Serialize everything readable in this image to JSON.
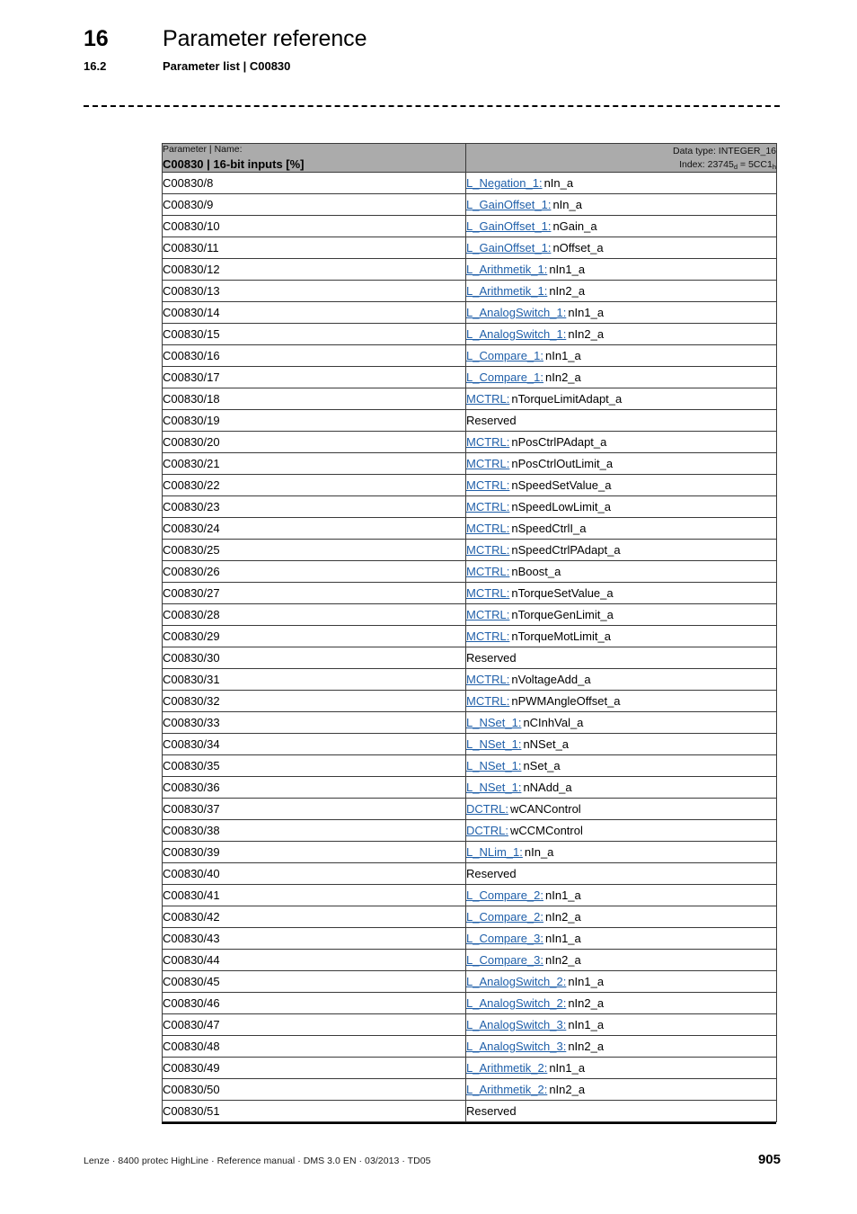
{
  "header": {
    "chapter_number": "16",
    "chapter_title": "Parameter reference",
    "section_number": "16.2",
    "section_title": "Parameter list | C00830"
  },
  "table": {
    "head": {
      "caption": "Parameter | Name:",
      "title": "C00830 | 16-bit inputs [%]",
      "data_type": "Data type: INTEGER_16",
      "index_label": "Index:",
      "index_dec": "23745",
      "index_dec_sub": "d",
      "index_eq": "=",
      "index_hex": "5CC1",
      "index_hex_sub": "h"
    },
    "rows": [
      {
        "code": "C00830/8",
        "link": "L_Negation_1:",
        "signal": "nIn_a"
      },
      {
        "code": "C00830/9",
        "link": "L_GainOffset_1:",
        "signal": "nIn_a"
      },
      {
        "code": "C00830/10",
        "link": "L_GainOffset_1:",
        "signal": "nGain_a"
      },
      {
        "code": "C00830/11",
        "link": "L_GainOffset_1:",
        "signal": "nOffset_a"
      },
      {
        "code": "C00830/12",
        "link": "L_Arithmetik_1:",
        "signal": "nIn1_a"
      },
      {
        "code": "C00830/13",
        "link": "L_Arithmetik_1:",
        "signal": "nIn2_a"
      },
      {
        "code": "C00830/14",
        "link": "L_AnalogSwitch_1:",
        "signal": "nIn1_a"
      },
      {
        "code": "C00830/15",
        "link": "L_AnalogSwitch_1:",
        "signal": "nIn2_a"
      },
      {
        "code": "C00830/16",
        "link": "L_Compare_1:",
        "signal": "nIn1_a"
      },
      {
        "code": "C00830/17",
        "link": "L_Compare_1:",
        "signal": "nIn2_a"
      },
      {
        "code": "C00830/18",
        "link": "MCTRL:",
        "signal": "nTorqueLimitAdapt_a"
      },
      {
        "code": "C00830/19",
        "link": "",
        "signal": "Reserved"
      },
      {
        "code": "C00830/20",
        "link": "MCTRL:",
        "signal": "nPosCtrlPAdapt_a"
      },
      {
        "code": "C00830/21",
        "link": "MCTRL:",
        "signal": "nPosCtrlOutLimit_a"
      },
      {
        "code": "C00830/22",
        "link": "MCTRL:",
        "signal": "nSpeedSetValue_a"
      },
      {
        "code": "C00830/23",
        "link": "MCTRL:",
        "signal": "nSpeedLowLimit_a"
      },
      {
        "code": "C00830/24",
        "link": "MCTRL:",
        "signal": "nSpeedCtrlI_a"
      },
      {
        "code": "C00830/25",
        "link": "MCTRL:",
        "signal": "nSpeedCtrlPAdapt_a"
      },
      {
        "code": "C00830/26",
        "link": "MCTRL:",
        "signal": "nBoost_a"
      },
      {
        "code": "C00830/27",
        "link": "MCTRL:",
        "signal": "nTorqueSetValue_a"
      },
      {
        "code": "C00830/28",
        "link": "MCTRL:",
        "signal": "nTorqueGenLimit_a"
      },
      {
        "code": "C00830/29",
        "link": "MCTRL:",
        "signal": "nTorqueMotLimit_a"
      },
      {
        "code": "C00830/30",
        "link": "",
        "signal": "Reserved"
      },
      {
        "code": "C00830/31",
        "link": "MCTRL:",
        "signal": "nVoltageAdd_a"
      },
      {
        "code": "C00830/32",
        "link": "MCTRL:",
        "signal": "nPWMAngleOffset_a"
      },
      {
        "code": "C00830/33",
        "link": "L_NSet_1:",
        "signal": "nCInhVal_a"
      },
      {
        "code": "C00830/34",
        "link": "L_NSet_1:",
        "signal": "nNSet_a"
      },
      {
        "code": "C00830/35",
        "link": "L_NSet_1:",
        "signal": "nSet_a"
      },
      {
        "code": "C00830/36",
        "link": "L_NSet_1:",
        "signal": "nNAdd_a"
      },
      {
        "code": "C00830/37",
        "link": "DCTRL:",
        "signal": "wCANControl"
      },
      {
        "code": "C00830/38",
        "link": "DCTRL:",
        "signal": "wCCMControl"
      },
      {
        "code": "C00830/39",
        "link": "L_NLim_1:",
        "signal": "nIn_a"
      },
      {
        "code": "C00830/40",
        "link": "",
        "signal": "Reserved"
      },
      {
        "code": "C00830/41",
        "link": "L_Compare_2:",
        "signal": "nIn1_a"
      },
      {
        "code": "C00830/42",
        "link": "L_Compare_2:",
        "signal": "nIn2_a"
      },
      {
        "code": "C00830/43",
        "link": "L_Compare_3:",
        "signal": "nIn1_a"
      },
      {
        "code": "C00830/44",
        "link": "L_Compare_3:",
        "signal": "nIn2_a"
      },
      {
        "code": "C00830/45",
        "link": "L_AnalogSwitch_2:",
        "signal": "nIn1_a"
      },
      {
        "code": "C00830/46",
        "link": "L_AnalogSwitch_2:",
        "signal": "nIn2_a"
      },
      {
        "code": "C00830/47",
        "link": "L_AnalogSwitch_3:",
        "signal": "nIn1_a"
      },
      {
        "code": "C00830/48",
        "link": "L_AnalogSwitch_3:",
        "signal": "nIn2_a"
      },
      {
        "code": "C00830/49",
        "link": "L_Arithmetik_2:",
        "signal": "nIn1_a"
      },
      {
        "code": "C00830/50",
        "link": "L_Arithmetik_2:",
        "signal": "nIn2_a"
      },
      {
        "code": "C00830/51",
        "link": "",
        "signal": "Reserved"
      }
    ]
  },
  "footer": {
    "text": "Lenze · 8400 protec HighLine · Reference manual · DMS 3.0 EN · 03/2013 · TD05",
    "page": "905"
  },
  "colors": {
    "link_blue": "#1F5FA9",
    "header_gray": "#ABABAB",
    "border_gray": "#3A3A3A"
  }
}
